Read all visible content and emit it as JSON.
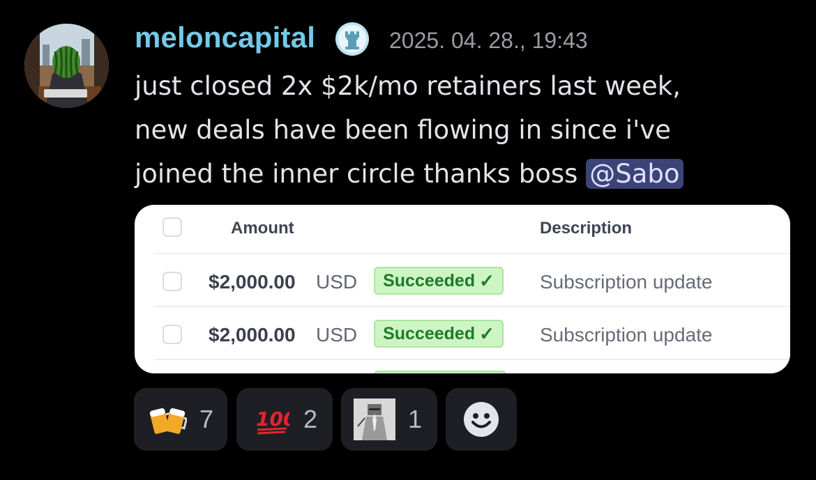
{
  "message": {
    "author": "meloncapital",
    "timestamp": "2025. 04. 28., 19:43",
    "line1": "just closed 2x $2k/mo retainers last week,",
    "line2": "new deals have been flowing in since i've",
    "line3_prefix": "joined the inner circle thanks boss ",
    "mention": "@Sabo"
  },
  "attachment": {
    "headers": {
      "amount": "Amount",
      "description": "Description"
    },
    "rows": [
      {
        "amount": "$2,000.00",
        "currency": "USD",
        "status": "Succeeded",
        "description": "Subscription update"
      },
      {
        "amount": "$2,000.00",
        "currency": "USD",
        "status": "Succeeded",
        "description": "Subscription update"
      }
    ]
  },
  "reactions": [
    {
      "icon": "beer-mugs-icon",
      "count": "7"
    },
    {
      "icon": "hundred-points-icon",
      "count": "2"
    },
    {
      "icon": "praying-knight-icon",
      "count": "1"
    },
    {
      "icon": "add-reaction-smiley-icon"
    }
  ],
  "colors": {
    "username": "#75c8e6",
    "mention_bg": "#3c4377",
    "status_bg": "#cdf5c3",
    "status_text": "#1f7a2c"
  }
}
